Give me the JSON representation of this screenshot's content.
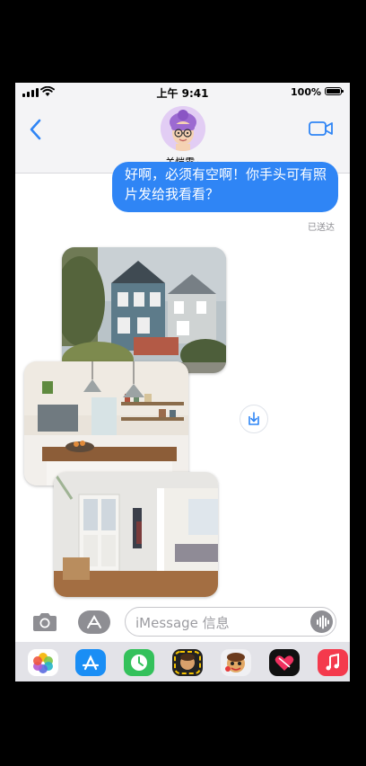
{
  "status_bar": {
    "time": "上午 9:41",
    "battery": "100%"
  },
  "header": {
    "contact_name": "关恺霖",
    "chevron": "›"
  },
  "messages": [
    {
      "text": "好啊，必须有空啊！你手头可有照片发给我看看？",
      "status": "已送达"
    }
  ],
  "input": {
    "placeholder": "iMessage 信息"
  },
  "colors": {
    "accent": "#2f85f5",
    "bubble_text": "#ffffff",
    "background": "#ffffff"
  },
  "app_drawer": [
    "photos-app-icon",
    "app-store-icon",
    "activity-app-icon",
    "memoji-app-icon",
    "memoji-stickers-icon",
    "digital-touch-icon",
    "music-app-icon"
  ]
}
